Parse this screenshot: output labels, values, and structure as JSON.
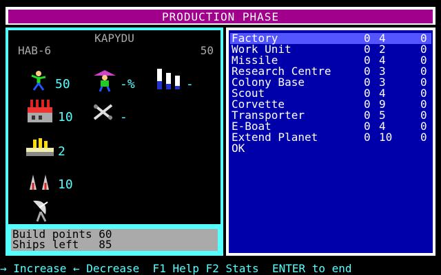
{
  "header": {
    "title": "PRODUCTION PHASE"
  },
  "planet": {
    "name": "KAPYDU",
    "hab": "HAB-6",
    "population": "50",
    "workers": "50",
    "tax": "-%",
    "stock": "-",
    "factories": "10",
    "tools": "-",
    "gold": "2",
    "ships": "10"
  },
  "stats": {
    "build_points": "Build points 60",
    "ships_left": "Ships left   85"
  },
  "build_list": [
    {
      "name": "Factory",
      "col1": "0",
      "col2": "4",
      "col3": "0"
    },
    {
      "name": "Work Unit",
      "col1": "0",
      "col2": "2",
      "col3": "0"
    },
    {
      "name": "Missile",
      "col1": "0",
      "col2": "4",
      "col3": "0"
    },
    {
      "name": "Research Centre",
      "col1": "0",
      "col2": "3",
      "col3": "0"
    },
    {
      "name": "Colony Base",
      "col1": "0",
      "col2": "3",
      "col3": "0"
    },
    {
      "name": "Scout",
      "col1": "0",
      "col2": "4",
      "col3": "0"
    },
    {
      "name": "Corvette",
      "col1": "0",
      "col2": "9",
      "col3": "0"
    },
    {
      "name": "Transporter",
      "col1": "0",
      "col2": "5",
      "col3": "0"
    },
    {
      "name": "E-Boat",
      "col1": "0",
      "col2": "4",
      "col3": "0"
    },
    {
      "name": "Extend Planet",
      "col1": "0",
      "col2": "10",
      "col3": "0"
    },
    {
      "name": "OK",
      "col1": "",
      "col2": "",
      "col3": ""
    }
  ],
  "footer": {
    "help": "→ Increase ← Decrease  F1 Help F2 Stats  ENTER to end"
  },
  "colors": {
    "title_bg": "#a0008c",
    "cyan": "#55ffff",
    "list_bg": "#0000aa",
    "selected": "#5555ff"
  }
}
